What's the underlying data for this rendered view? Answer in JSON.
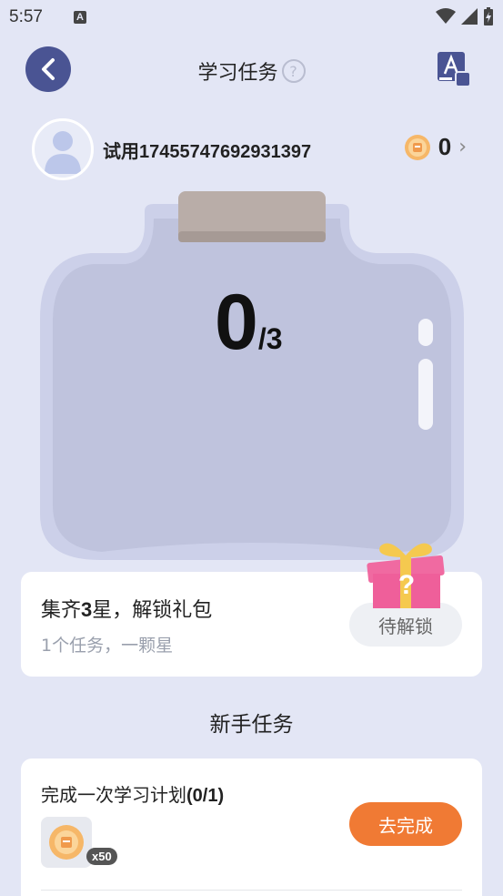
{
  "status_bar": {
    "time": "5:57",
    "a_badge": "A"
  },
  "header": {
    "title": "学习任务",
    "help": "?"
  },
  "user": {
    "name": "试用17455747692931397",
    "coins": "0",
    "chevron": "›"
  },
  "jar": {
    "current": "0",
    "total": "/3"
  },
  "unlock": {
    "title_pre": "集齐",
    "title_num": "3",
    "title_post": "星，解锁礼包",
    "subtitle": "1个任务，一颗星",
    "button": "待解锁"
  },
  "section": {
    "title": "新手任务"
  },
  "task": {
    "title_text": "完成一次学习计划",
    "progress": "(0/1)",
    "reward_qty": "x50",
    "button": "去完成"
  },
  "colors": {
    "primary_button": "#4a5493",
    "accent": "#f07a34",
    "background": "#e3e6f5"
  }
}
